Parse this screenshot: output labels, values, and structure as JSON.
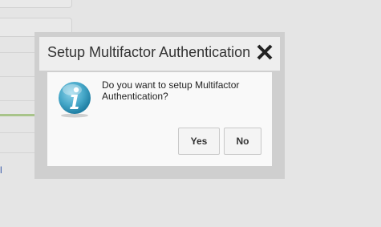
{
  "dialog": {
    "title": "Setup Multifactor Authentication",
    "message": "Do you want to setup Multifactor Authentication?",
    "yes_label": "Yes",
    "no_label": "No",
    "close_icon": "close-icon",
    "info_icon": "info-icon"
  },
  "background": {
    "link_text": "l",
    "accent_color": "#a8c48a"
  },
  "colors": {
    "info_icon": "#45a7c8",
    "dialog_border": "#cfcfcf"
  }
}
